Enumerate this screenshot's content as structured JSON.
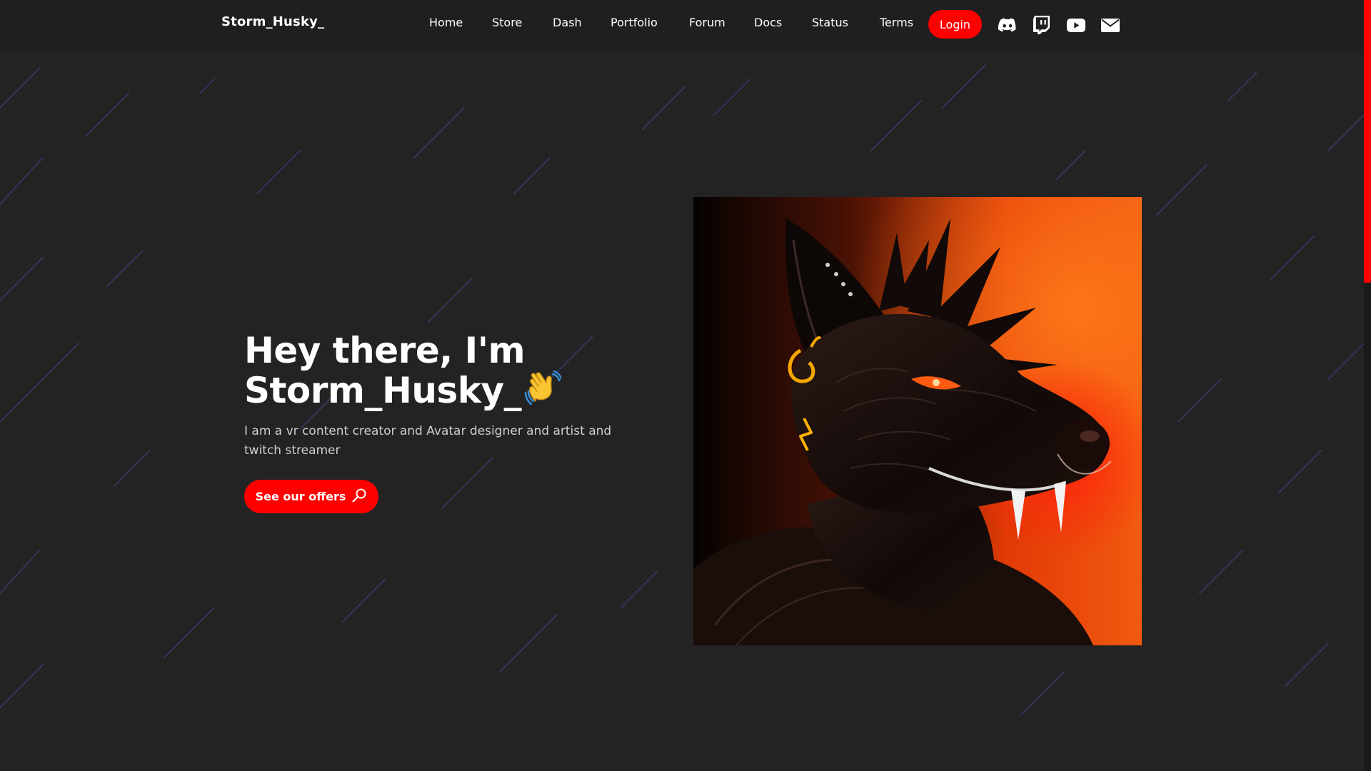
{
  "header": {
    "brand": "Storm_Husky_",
    "nav": [
      "Home",
      "Store",
      "Dash",
      "Portfolio",
      "Forum",
      "Docs",
      "Status",
      "Terms"
    ],
    "login_label": "Login",
    "social": [
      "discord-icon",
      "twitch-icon",
      "youtube-icon",
      "mail-icon"
    ]
  },
  "hero": {
    "title_line1": "Hey there, I'm",
    "title_line2": "Storm_Husky_",
    "wave_icon": "waving-hand-icon",
    "description": "I am a vr content creator and Avatar designer and artist and twitch streamer",
    "cta_label": "See our offers",
    "cta_icon": "search-icon",
    "avatar_icon": "black-wolf-avatar-image"
  },
  "colors": {
    "accent": "#ff0000",
    "background": "#232324",
    "navbar": "#1f1f20",
    "text": "#ffffff",
    "muted_text": "#cfcfcf",
    "rain": "#363a60"
  }
}
